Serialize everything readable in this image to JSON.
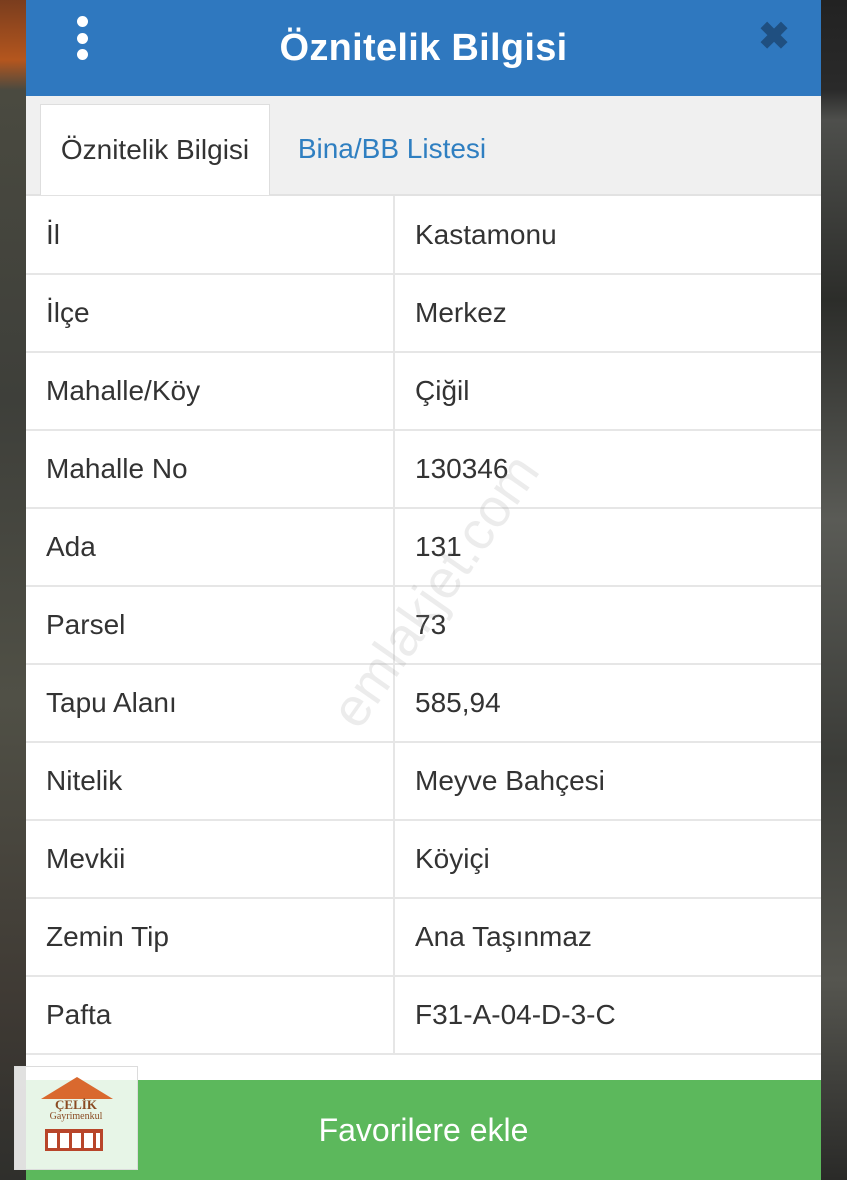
{
  "dialog": {
    "title": "Öznitelik Bilgisi",
    "close_symbol": "✖"
  },
  "tabs": [
    {
      "label": "Öznitelik Bilgisi",
      "active": true
    },
    {
      "label": "Bina/BB Listesi",
      "active": false
    }
  ],
  "rows": [
    {
      "key": "İl",
      "value": "Kastamonu"
    },
    {
      "key": "İlçe",
      "value": "Merkez"
    },
    {
      "key": "Mahalle/Köy",
      "value": "Çiğil"
    },
    {
      "key": "Mahalle No",
      "value": "130346"
    },
    {
      "key": "Ada",
      "value": "131"
    },
    {
      "key": "Parsel",
      "value": "73"
    },
    {
      "key": "Tapu Alanı",
      "value": "585,94"
    },
    {
      "key": "Nitelik",
      "value": "Meyve Bahçesi"
    },
    {
      "key": "Mevkii",
      "value": "Köyiçi"
    },
    {
      "key": "Zemin Tip",
      "value": "Ana Taşınmaz"
    },
    {
      "key": "Pafta",
      "value": "F31-A-04-D-3-C"
    }
  ],
  "favorite_button": "Favorilere ekle",
  "watermark": "emlakjet.com",
  "logo": {
    "name": "ÇELİK",
    "sub": "Gayrimenkul"
  },
  "colors": {
    "header": "#2f78bf",
    "tab_inactive_text": "#2f7fc1",
    "favorite_button": "#5cb85c"
  }
}
